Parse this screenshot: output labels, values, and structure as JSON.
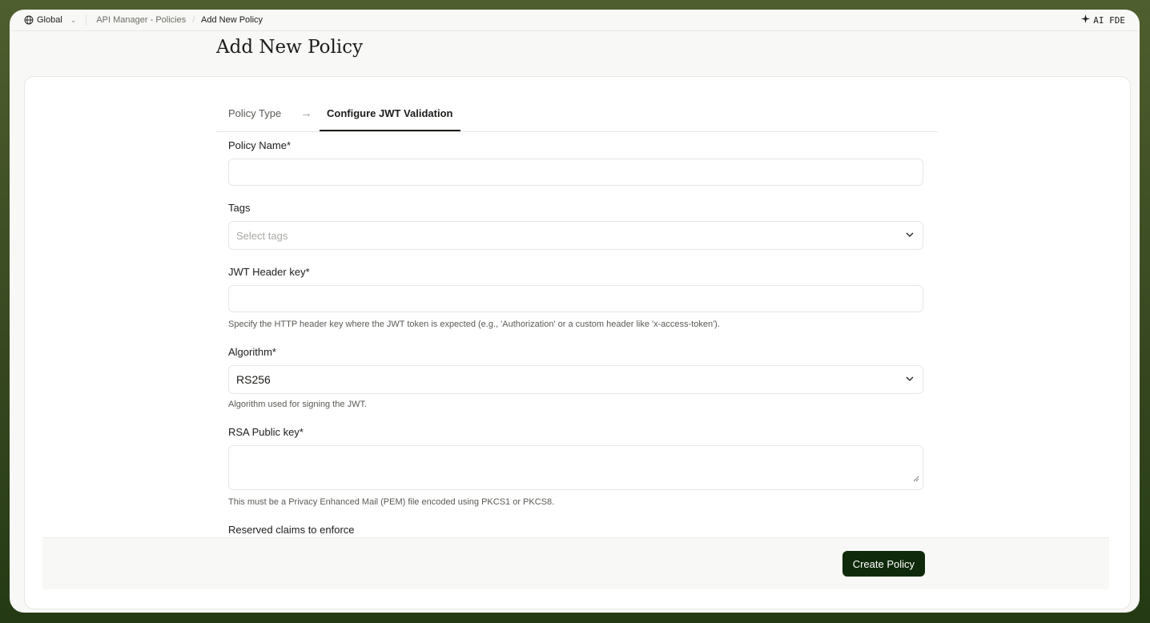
{
  "topbar": {
    "scope_label": "Global",
    "breadcrumb": [
      "API Manager - Policies",
      "Add New Policy"
    ],
    "ai_badge": "AI FDE"
  },
  "page": {
    "title": "Add New Policy"
  },
  "steps": [
    {
      "label": "Policy Type",
      "active": false
    },
    {
      "label": "Configure JWT Validation",
      "active": true
    }
  ],
  "form": {
    "policy_name": {
      "label": "Policy Name*",
      "value": ""
    },
    "tags": {
      "label": "Tags",
      "placeholder": "Select tags"
    },
    "jwt_header_key": {
      "label": "JWT Header key*",
      "value": "",
      "hint": "Specify the HTTP header key where the JWT token is expected (e.g., 'Authorization' or a custom header like 'x-access-token')."
    },
    "algorithm": {
      "label": "Algorithm*",
      "value": "RS256",
      "hint": "Algorithm used for signing the JWT."
    },
    "rsa_public_key": {
      "label": "RSA Public key*",
      "value": "",
      "hint": "This must be a Privacy Enhanced Mail (PEM) file encoded using PKCS1 or PKCS8."
    },
    "reserved_claims": {
      "label": "Reserved claims to enforce"
    }
  },
  "footer": {
    "create_label": "Create Policy",
    "create_color": "#0f2a0a"
  }
}
